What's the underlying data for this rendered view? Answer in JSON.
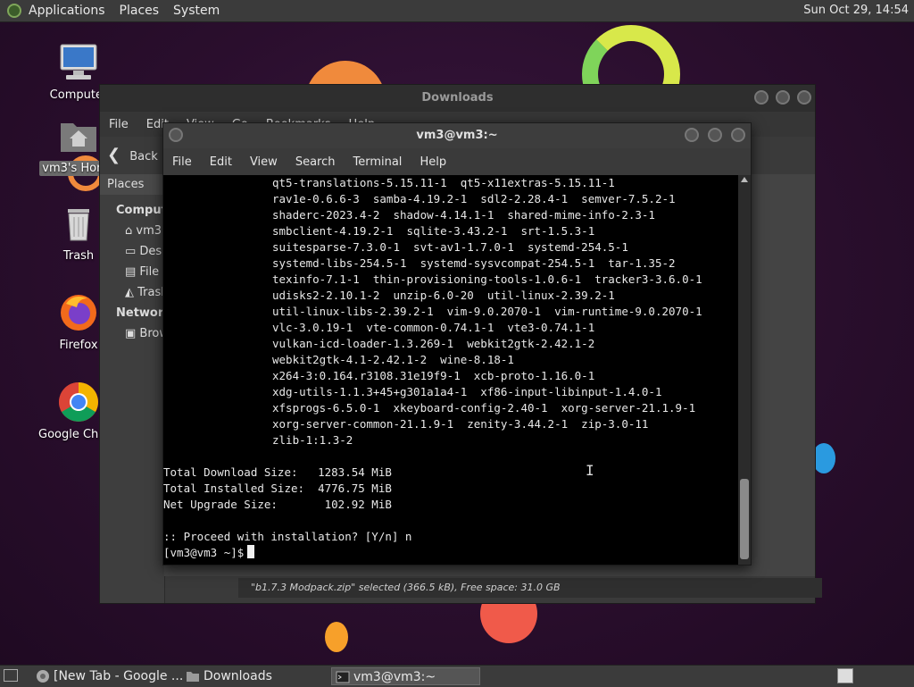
{
  "top_panel": {
    "menus": [
      "Applications",
      "Places",
      "System"
    ],
    "clock": "Sun Oct 29, 14:54"
  },
  "desktop_icons": {
    "computer": "Computer",
    "home": "vm3's Home",
    "trash": "Trash",
    "firefox": "Firefox",
    "chrome": "Google Chrome"
  },
  "file_manager": {
    "title": "Downloads",
    "menu": [
      "File",
      "Edit",
      "View",
      "Go",
      "Bookmarks",
      "Help"
    ],
    "back_label": "Back",
    "sidebar": {
      "places_header": "Places",
      "computer_header": "Computer",
      "items": [
        "vm3",
        "Desktop",
        "File System",
        "Trash"
      ],
      "network_header": "Network",
      "network_items": [
        "Browse Network"
      ]
    },
    "status": "\"b1.7.3 Modpack.zip\" selected (366.5 kB), Free space: 31.0 GB"
  },
  "terminal": {
    "title": "vm3@vm3:~",
    "menu": [
      "File",
      "Edit",
      "View",
      "Search",
      "Terminal",
      "Help"
    ],
    "package_lines": [
      "qt5-translations-5.15.11-1  qt5-x11extras-5.15.11-1",
      "rav1e-0.6.6-3  samba-4.19.2-1  sdl2-2.28.4-1  semver-7.5.2-1",
      "shaderc-2023.4-2  shadow-4.14.1-1  shared-mime-info-2.3-1",
      "smbclient-4.19.2-1  sqlite-3.43.2-1  srt-1.5.3-1",
      "suitesparse-7.3.0-1  svt-av1-1.7.0-1  systemd-254.5-1",
      "systemd-libs-254.5-1  systemd-sysvcompat-254.5-1  tar-1.35-2",
      "texinfo-7.1-1  thin-provisioning-tools-1.0.6-1  tracker3-3.6.0-1",
      "udisks2-2.10.1-2  unzip-6.0-20  util-linux-2.39.2-1",
      "util-linux-libs-2.39.2-1  vim-9.0.2070-1  vim-runtime-9.0.2070-1",
      "vlc-3.0.19-1  vte-common-0.74.1-1  vte3-0.74.1-1",
      "vulkan-icd-loader-1.3.269-1  webkit2gtk-2.42.1-2",
      "webkit2gtk-4.1-2.42.1-2  wine-8.18-1",
      "x264-3:0.164.r3108.31e19f9-1  xcb-proto-1.16.0-1",
      "xdg-utils-1.1.3+45+g301a1a4-1  xf86-input-libinput-1.4.0-1",
      "xfsprogs-6.5.0-1  xkeyboard-config-2.40-1  xorg-server-21.1.9-1",
      "xorg-server-common-21.1.9-1  zenity-3.44.2-1  zip-3.0-11",
      "zlib-1:1.3-2"
    ],
    "summary_lines": [
      "Total Download Size:   1283.54 MiB",
      "Total Installed Size:  4776.75 MiB",
      "Net Upgrade Size:       102.92 MiB"
    ],
    "proceed_line": ":: Proceed with installation? [Y/n] n",
    "prompt": "[vm3@vm3 ~]$"
  },
  "taskbar": {
    "tasks": [
      "[New Tab - Google ...",
      "Downloads",
      "vm3@vm3:~"
    ]
  }
}
